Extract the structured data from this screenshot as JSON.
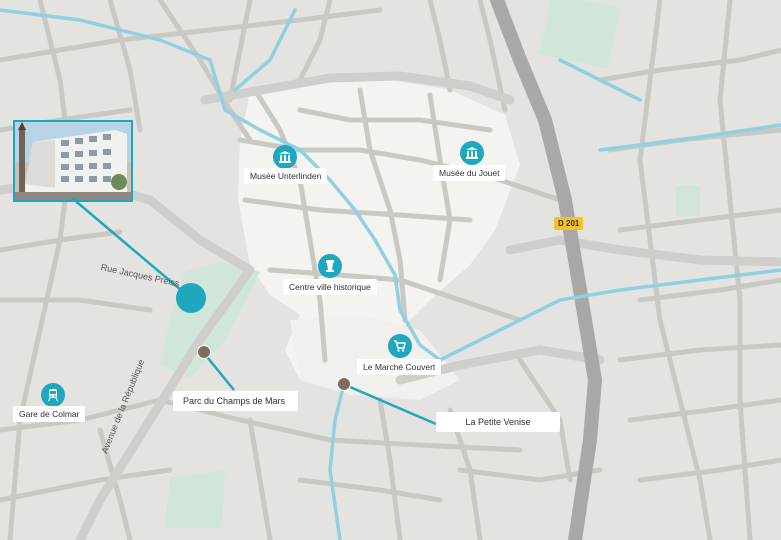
{
  "map": {
    "places": [
      {
        "id": "unterlinden",
        "label": "Musée Unterlinden",
        "icon": "museum-icon"
      },
      {
        "id": "jouet",
        "label": "Musée du Jouet",
        "icon": "museum-icon"
      },
      {
        "id": "centre",
        "label": "Centre ville historique",
        "icon": "tower-icon"
      },
      {
        "id": "marche",
        "label": "Le Marché Couvert",
        "icon": "shopping-cart-icon"
      },
      {
        "id": "gare",
        "label": "Gare de Colmar",
        "icon": "train-icon"
      }
    ],
    "callouts": {
      "parc": "Parc du Champs de Mars",
      "venise": "La Petite Venise"
    },
    "streets": {
      "jacques_preiss": "Rue Jacques Preiss",
      "republique": "Avenue de la République"
    },
    "road_badge": "D 201",
    "colors": {
      "accent": "#1fa7c0",
      "land": "#e4e3df",
      "roads": "#c9c8c3",
      "water": "#8fd0e2",
      "parks": "#cfe6d8",
      "old_town": "#f4f3ef",
      "highway": "#a9a8a5",
      "badge": "#f5c02a"
    }
  }
}
